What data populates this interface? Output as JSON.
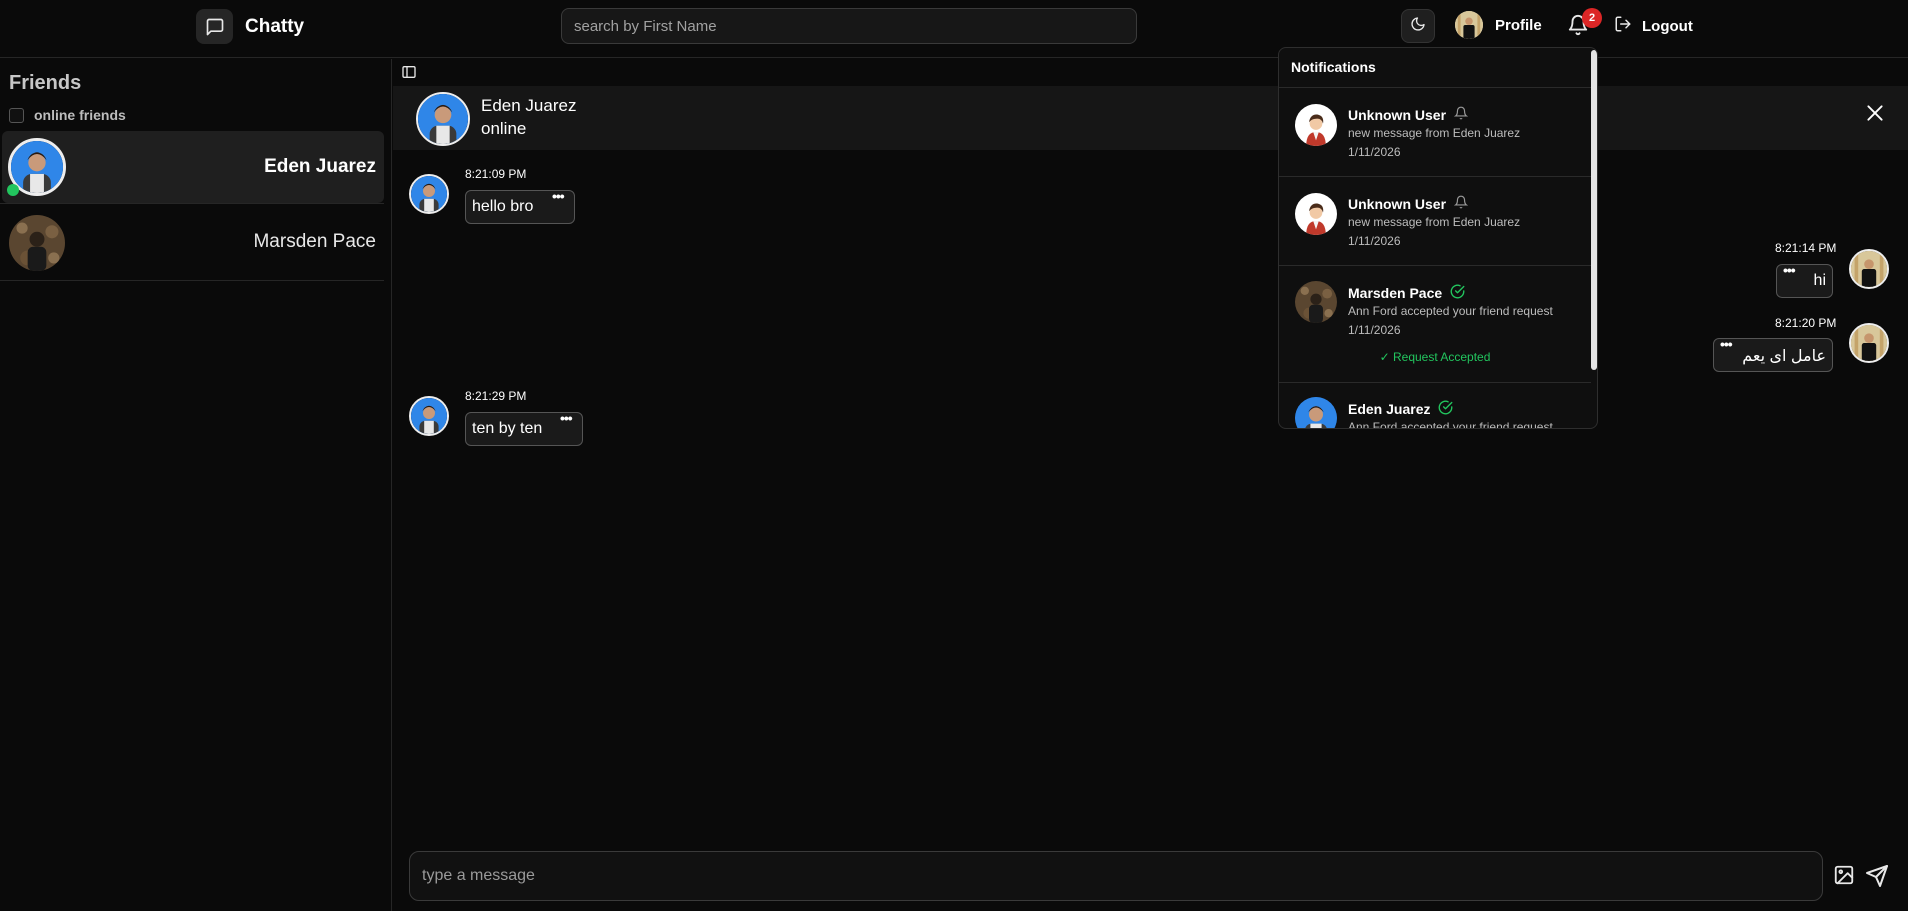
{
  "app": {
    "title": "Chatty",
    "logo_icon": "chat-bubble-icon"
  },
  "header": {
    "search_placeholder": "search by First Name",
    "theme_icon": "moon-icon",
    "profile_label": "Profile",
    "notification_count": "2",
    "logout_label": "Logout"
  },
  "sidebar": {
    "title": "Friends",
    "online_toggle_label": "online friends",
    "friends": [
      {
        "name": "Eden Juarez",
        "online": true,
        "active": true
      },
      {
        "name": "Marsden Pace",
        "online": false,
        "active": false
      }
    ]
  },
  "chat": {
    "contact_name": "Eden Juarez",
    "contact_status": "online",
    "messages": [
      {
        "side": "left",
        "time": "8:21:09 PM",
        "text": "hello bro"
      },
      {
        "side": "right",
        "time": "8:21:14 PM",
        "text": "hi"
      },
      {
        "side": "right",
        "time": "8:21:20 PM",
        "text": "عامل اى يعم"
      },
      {
        "side": "left",
        "time": "8:21:29 PM",
        "text": "ten by ten"
      }
    ],
    "composer_placeholder": "type a message",
    "menu_glyph": "•••"
  },
  "notifications": {
    "title": "Notifications",
    "items": [
      {
        "name": "Unknown User",
        "type_icon": "bell-icon",
        "text": "new message from Eden Juarez",
        "date": "1/11/2026",
        "status": ""
      },
      {
        "name": "Unknown User",
        "type_icon": "bell-icon",
        "text": "new message from Eden Juarez",
        "date": "1/11/2026",
        "status": ""
      },
      {
        "name": "Marsden Pace",
        "type_icon": "check-circle-icon",
        "text": "Ann Ford accepted your friend request",
        "date": "1/11/2026",
        "status": "✓ Request Accepted"
      },
      {
        "name": "Eden Juarez",
        "type_icon": "check-circle-icon",
        "text": "Ann Ford accepted your friend request",
        "date": "",
        "status": ""
      }
    ]
  },
  "colors": {
    "accent_green": "#22c55e",
    "badge_red": "#dc2626",
    "background": "#0a0a0a"
  }
}
